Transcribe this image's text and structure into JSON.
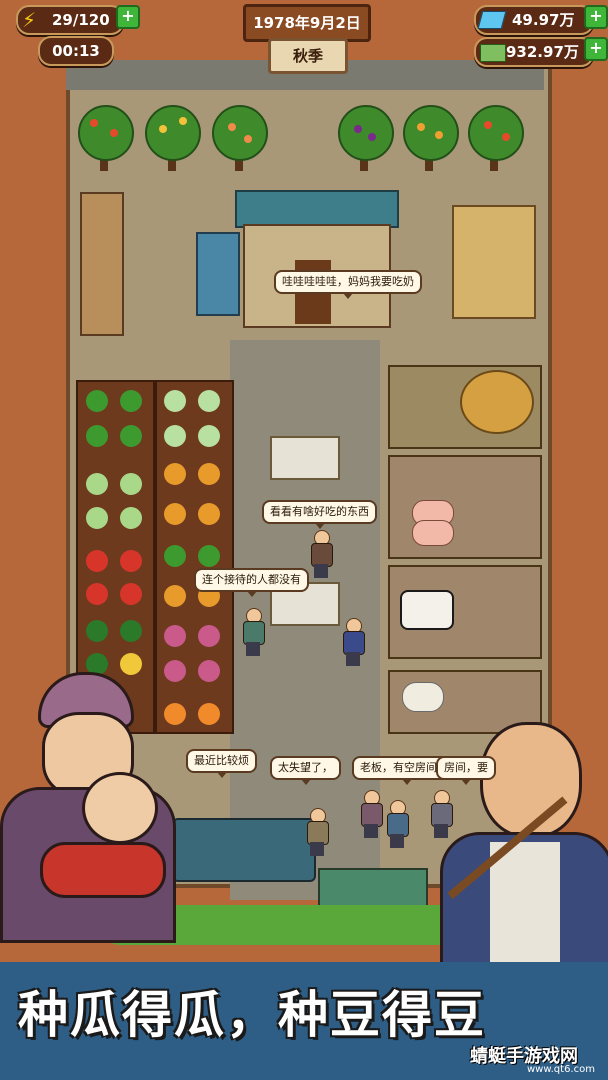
{
  "hud": {
    "energy": "29/120",
    "timer": "00:13",
    "date": "1978年9月2日",
    "season": "秋季",
    "diamonds": "49.97万",
    "cash": "932.97万",
    "colors": {
      "panel": "#5a2a14",
      "plus": "#3fb53a",
      "energy": "#f5c518",
      "diamond": "#5fc6f0",
      "cash": "#7fbf5f"
    }
  },
  "speech": {
    "baby_cry": "哇哇哇哇哇，妈妈我要吃奶",
    "look_food": "看看有啥好吃的东西",
    "no_receiver": "连个接待的人都没有",
    "lately": "最近比较烦",
    "disappointed": "太失望了，",
    "room_ask": "老板，有空房间没?",
    "room_cut": "房间，要"
  },
  "slogan": "种瓜得瓜，种豆得豆",
  "watermark": {
    "name": "蜻蜓手游戏网",
    "url": "www.qt6.com"
  }
}
